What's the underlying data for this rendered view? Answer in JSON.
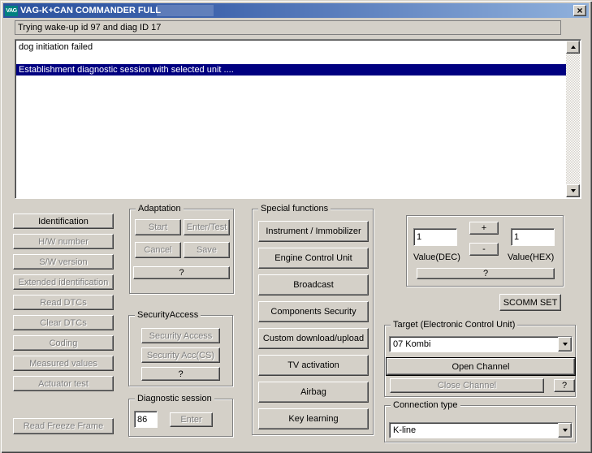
{
  "window": {
    "title": "VAG-K+CAN COMMANDER FULL",
    "icon_text": "VAG",
    "close_glyph": "×"
  },
  "status_line": "Trying wake-up id 97 and diag ID 17",
  "log": {
    "rows": [
      {
        "text": "dog initiation failed",
        "selected": false
      },
      {
        "text": "",
        "selected": false
      },
      {
        "text": "Establishment diagnostic session with selected unit ....",
        "selected": true
      }
    ]
  },
  "left_buttons": [
    {
      "label": "Identification",
      "enabled": true
    },
    {
      "label": "H/W number",
      "enabled": false
    },
    {
      "label": "S/W version",
      "enabled": false
    },
    {
      "label": "Extended identification",
      "enabled": false
    },
    {
      "label": "Read DTCs",
      "enabled": false
    },
    {
      "label": "Clear DTCs",
      "enabled": false
    },
    {
      "label": "Coding",
      "enabled": false
    },
    {
      "label": "Measured values",
      "enabled": false
    },
    {
      "label": "Actuator test",
      "enabled": false
    },
    {
      "label": "Read Freeze Frame",
      "enabled": false
    }
  ],
  "adaptation": {
    "title": "Adaptation",
    "start": "Start",
    "enter_test": "Enter/Test",
    "cancel": "Cancel",
    "save": "Save",
    "help": "?"
  },
  "security": {
    "title": "SecurityAccess",
    "access": "Security Access",
    "access_cs": "Security Acc(CS)",
    "help": "?"
  },
  "diagnostic_session": {
    "title": "Diagnostic session",
    "value": "86",
    "enter": "Enter"
  },
  "special_functions": {
    "title": "Special functions",
    "buttons": [
      "Instrument / Immobilizer",
      "Engine Control Unit",
      "Broadcast",
      "Components Security",
      "Custom download/upload",
      "TV activation",
      "Airbag",
      "Key learning"
    ]
  },
  "value_panel": {
    "dec_value": "1",
    "hex_value": "1",
    "plus": "+",
    "minus": "-",
    "dec_label": "Value(DEC)",
    "hex_label": "Value(HEX)",
    "help": "?"
  },
  "scomm_set": "SCOMM SET",
  "target": {
    "title": "Target (Electronic Control Unit)",
    "selected": "07 Kombi",
    "open_channel": "Open Channel",
    "close_channel": "Close Channel",
    "help": "?"
  },
  "connection": {
    "title": "Connection type",
    "selected": "K-line"
  },
  "colors": {
    "window_bg": "#D4D0C8",
    "titlebar_left": "#2C529E",
    "titlebar_right": "#90B1DC",
    "selection_bg": "#000080",
    "icon_bg": "#008080"
  }
}
